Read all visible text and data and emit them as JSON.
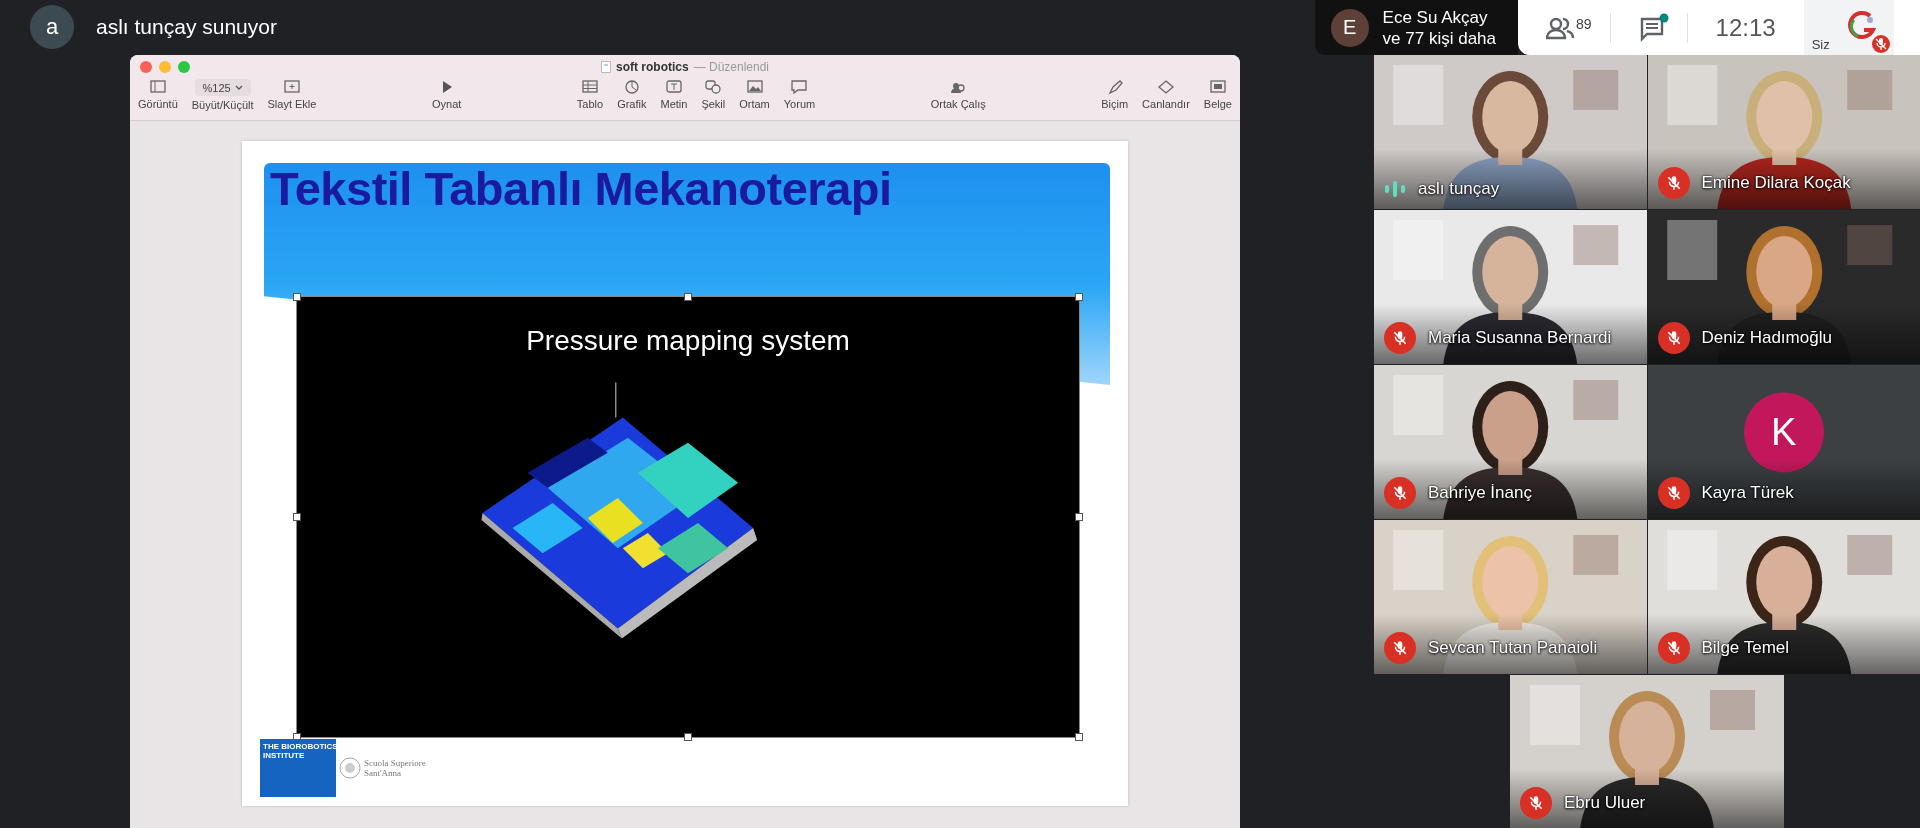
{
  "presenter": {
    "avatar": "a",
    "label": "aslı tunçay sunuyor"
  },
  "top_bar": {
    "avatar": "E",
    "people_line1": "Ece Su Akçay",
    "people_line2": "ve 77 kişi daha",
    "participants_count": "89",
    "chat_unread": true,
    "time": "12:13",
    "self_label": "Siz",
    "self_muted": true
  },
  "app_window": {
    "title": "soft robotics",
    "status": "— Düzenlendi",
    "toolbar": [
      [
        {
          "kind": "button",
          "label": "Görüntü"
        },
        {
          "kind": "dropdown",
          "value": "%125",
          "label": "Büyüt/Küçült"
        },
        {
          "kind": "button",
          "label": "Slayt Ekle"
        }
      ],
      [
        {
          "kind": "button",
          "label": "Oynat"
        }
      ],
      [
        {
          "kind": "button",
          "label": "Tablo"
        },
        {
          "kind": "button",
          "label": "Grafik"
        },
        {
          "kind": "button",
          "label": "Metin"
        },
        {
          "kind": "button",
          "label": "Şekil"
        },
        {
          "kind": "button",
          "label": "Ortam"
        },
        {
          "kind": "button",
          "label": "Yorum"
        }
      ],
      [
        {
          "kind": "button",
          "label": "Ortak Çalış"
        }
      ],
      [
        {
          "kind": "button",
          "label": "Biçim"
        },
        {
          "kind": "button",
          "label": "Canlandır"
        },
        {
          "kind": "button",
          "label": "Belge"
        }
      ]
    ]
  },
  "slide": {
    "title": "Tekstil Tabanlı Mekanoterapi",
    "media_title": "Pressure mapping system",
    "logo_lines": [
      "THE BIOROBOTICS",
      "INSTITUTE"
    ],
    "school_lines": [
      "Scuola Superiore",
      "Sant'Anna"
    ]
  },
  "participants": [
    {
      "kind": "video",
      "name": "aslı tunçay",
      "muted": false,
      "speaking": true
    },
    {
      "kind": "video",
      "name": "Emine Dilara Koçak",
      "muted": true,
      "speaking": false
    },
    {
      "kind": "video",
      "name": "Maria Susanna Bernardi",
      "muted": true,
      "speaking": false
    },
    {
      "kind": "video",
      "name": "Deniz Hadımoğlu",
      "muted": true,
      "speaking": false
    },
    {
      "kind": "video",
      "name": "Bahriye İnanç",
      "muted": true,
      "speaking": false
    },
    {
      "kind": "avatar",
      "name": "Kayra Türek",
      "initial": "K",
      "color": "#c2185b",
      "muted": true,
      "speaking": false
    },
    {
      "kind": "video",
      "name": "Sevcan Tutan Panaioli",
      "muted": true,
      "speaking": false
    },
    {
      "kind": "video",
      "name": "Bilge Temel",
      "muted": true,
      "speaking": false
    },
    {
      "kind": "video",
      "name": "Ebru Uluer",
      "muted": true,
      "speaking": false
    }
  ]
}
